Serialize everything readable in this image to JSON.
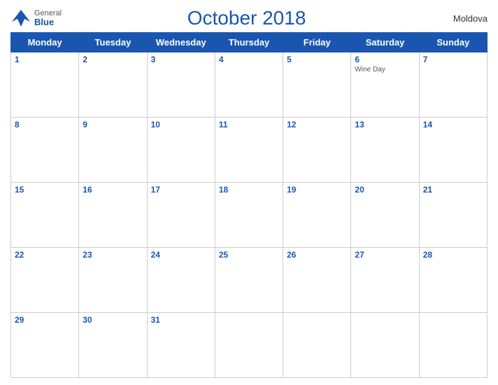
{
  "header": {
    "title": "October 2018",
    "country": "Moldova",
    "logo_general": "General",
    "logo_blue": "Blue"
  },
  "weekdays": [
    "Monday",
    "Tuesday",
    "Wednesday",
    "Thursday",
    "Friday",
    "Saturday",
    "Sunday"
  ],
  "weeks": [
    [
      {
        "day": "1",
        "holiday": ""
      },
      {
        "day": "2",
        "holiday": ""
      },
      {
        "day": "3",
        "holiday": ""
      },
      {
        "day": "4",
        "holiday": ""
      },
      {
        "day": "5",
        "holiday": ""
      },
      {
        "day": "6",
        "holiday": "Wine Day"
      },
      {
        "day": "7",
        "holiday": ""
      }
    ],
    [
      {
        "day": "8",
        "holiday": ""
      },
      {
        "day": "9",
        "holiday": ""
      },
      {
        "day": "10",
        "holiday": ""
      },
      {
        "day": "11",
        "holiday": ""
      },
      {
        "day": "12",
        "holiday": ""
      },
      {
        "day": "13",
        "holiday": ""
      },
      {
        "day": "14",
        "holiday": ""
      }
    ],
    [
      {
        "day": "15",
        "holiday": ""
      },
      {
        "day": "16",
        "holiday": ""
      },
      {
        "day": "17",
        "holiday": ""
      },
      {
        "day": "18",
        "holiday": ""
      },
      {
        "day": "19",
        "holiday": ""
      },
      {
        "day": "20",
        "holiday": ""
      },
      {
        "day": "21",
        "holiday": ""
      }
    ],
    [
      {
        "day": "22",
        "holiday": ""
      },
      {
        "day": "23",
        "holiday": ""
      },
      {
        "day": "24",
        "holiday": ""
      },
      {
        "day": "25",
        "holiday": ""
      },
      {
        "day": "26",
        "holiday": ""
      },
      {
        "day": "27",
        "holiday": ""
      },
      {
        "day": "28",
        "holiday": ""
      }
    ],
    [
      {
        "day": "29",
        "holiday": ""
      },
      {
        "day": "30",
        "holiday": ""
      },
      {
        "day": "31",
        "holiday": ""
      },
      {
        "day": "",
        "holiday": ""
      },
      {
        "day": "",
        "holiday": ""
      },
      {
        "day": "",
        "holiday": ""
      },
      {
        "day": "",
        "holiday": ""
      }
    ]
  ]
}
